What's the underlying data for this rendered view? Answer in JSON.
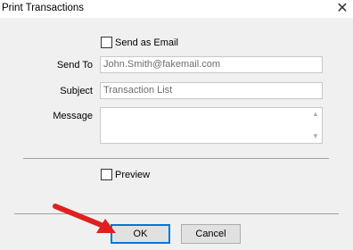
{
  "window": {
    "title": "Print Transactions",
    "close_icon": "close-icon"
  },
  "form": {
    "send_as_email": {
      "label": "Send as Email",
      "checked": false
    },
    "send_to": {
      "label": "Send To",
      "value": "John.Smith@fakemail.com"
    },
    "subject": {
      "label": "Subject",
      "value": "Transaction List"
    },
    "message": {
      "label": "Message",
      "value": ""
    },
    "preview": {
      "label": "Preview",
      "checked": false
    }
  },
  "buttons": {
    "ok": "OK",
    "cancel": "Cancel"
  },
  "annotation": {
    "arrow_color": "#e02020"
  }
}
